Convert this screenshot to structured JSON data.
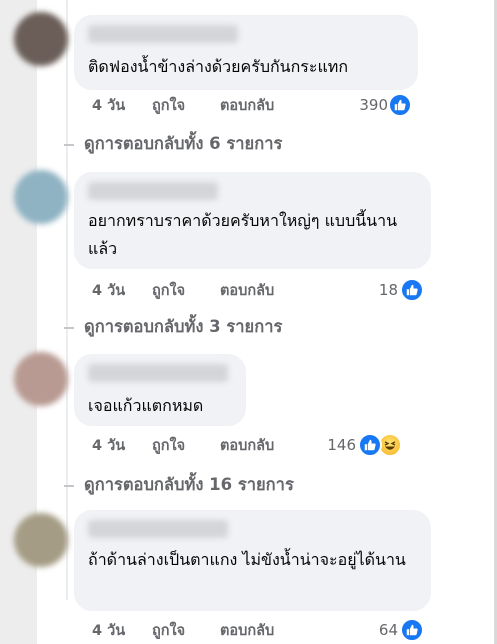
{
  "labels": {
    "like": "ถูกใจ",
    "reply": "ตอบกลับ"
  },
  "colors": {
    "like_blue": "#1877f2",
    "meta_gray": "#65676b",
    "bubble_bg": "#f0f2f5"
  },
  "comments": [
    {
      "text": "ติดฟองน้ำข้างล่างด้วยครับกันกระแทก",
      "time": "4 วัน",
      "reaction_count": "390",
      "reactions": [
        "like-icon"
      ]
    },
    {
      "text": "อยากทราบราคาด้วยครับหาใหญ่ๆ แบบนี้นานแล้ว",
      "time": "4 วัน",
      "reaction_count": "18",
      "reactions": [
        "like-icon"
      ]
    },
    {
      "text": "เจอแก้วแตกหมด",
      "time": "4 วัน",
      "reaction_count": "146",
      "reactions": [
        "like-icon",
        "haha-icon"
      ]
    },
    {
      "text": "ถ้าด้านล่างเป็นตาแกง ไม่ขังน้ำน่าจะอยู่ได้นาน",
      "time": "4 วัน",
      "reaction_count": "64",
      "reactions": [
        "like-icon"
      ]
    }
  ],
  "reply_links": [
    "ดูการตอบกลับทั้ง 6 รายการ",
    "ดูการตอบกลับทั้ง 3 รายการ",
    "ดูการตอบกลับทั้ง 16 รายการ"
  ]
}
